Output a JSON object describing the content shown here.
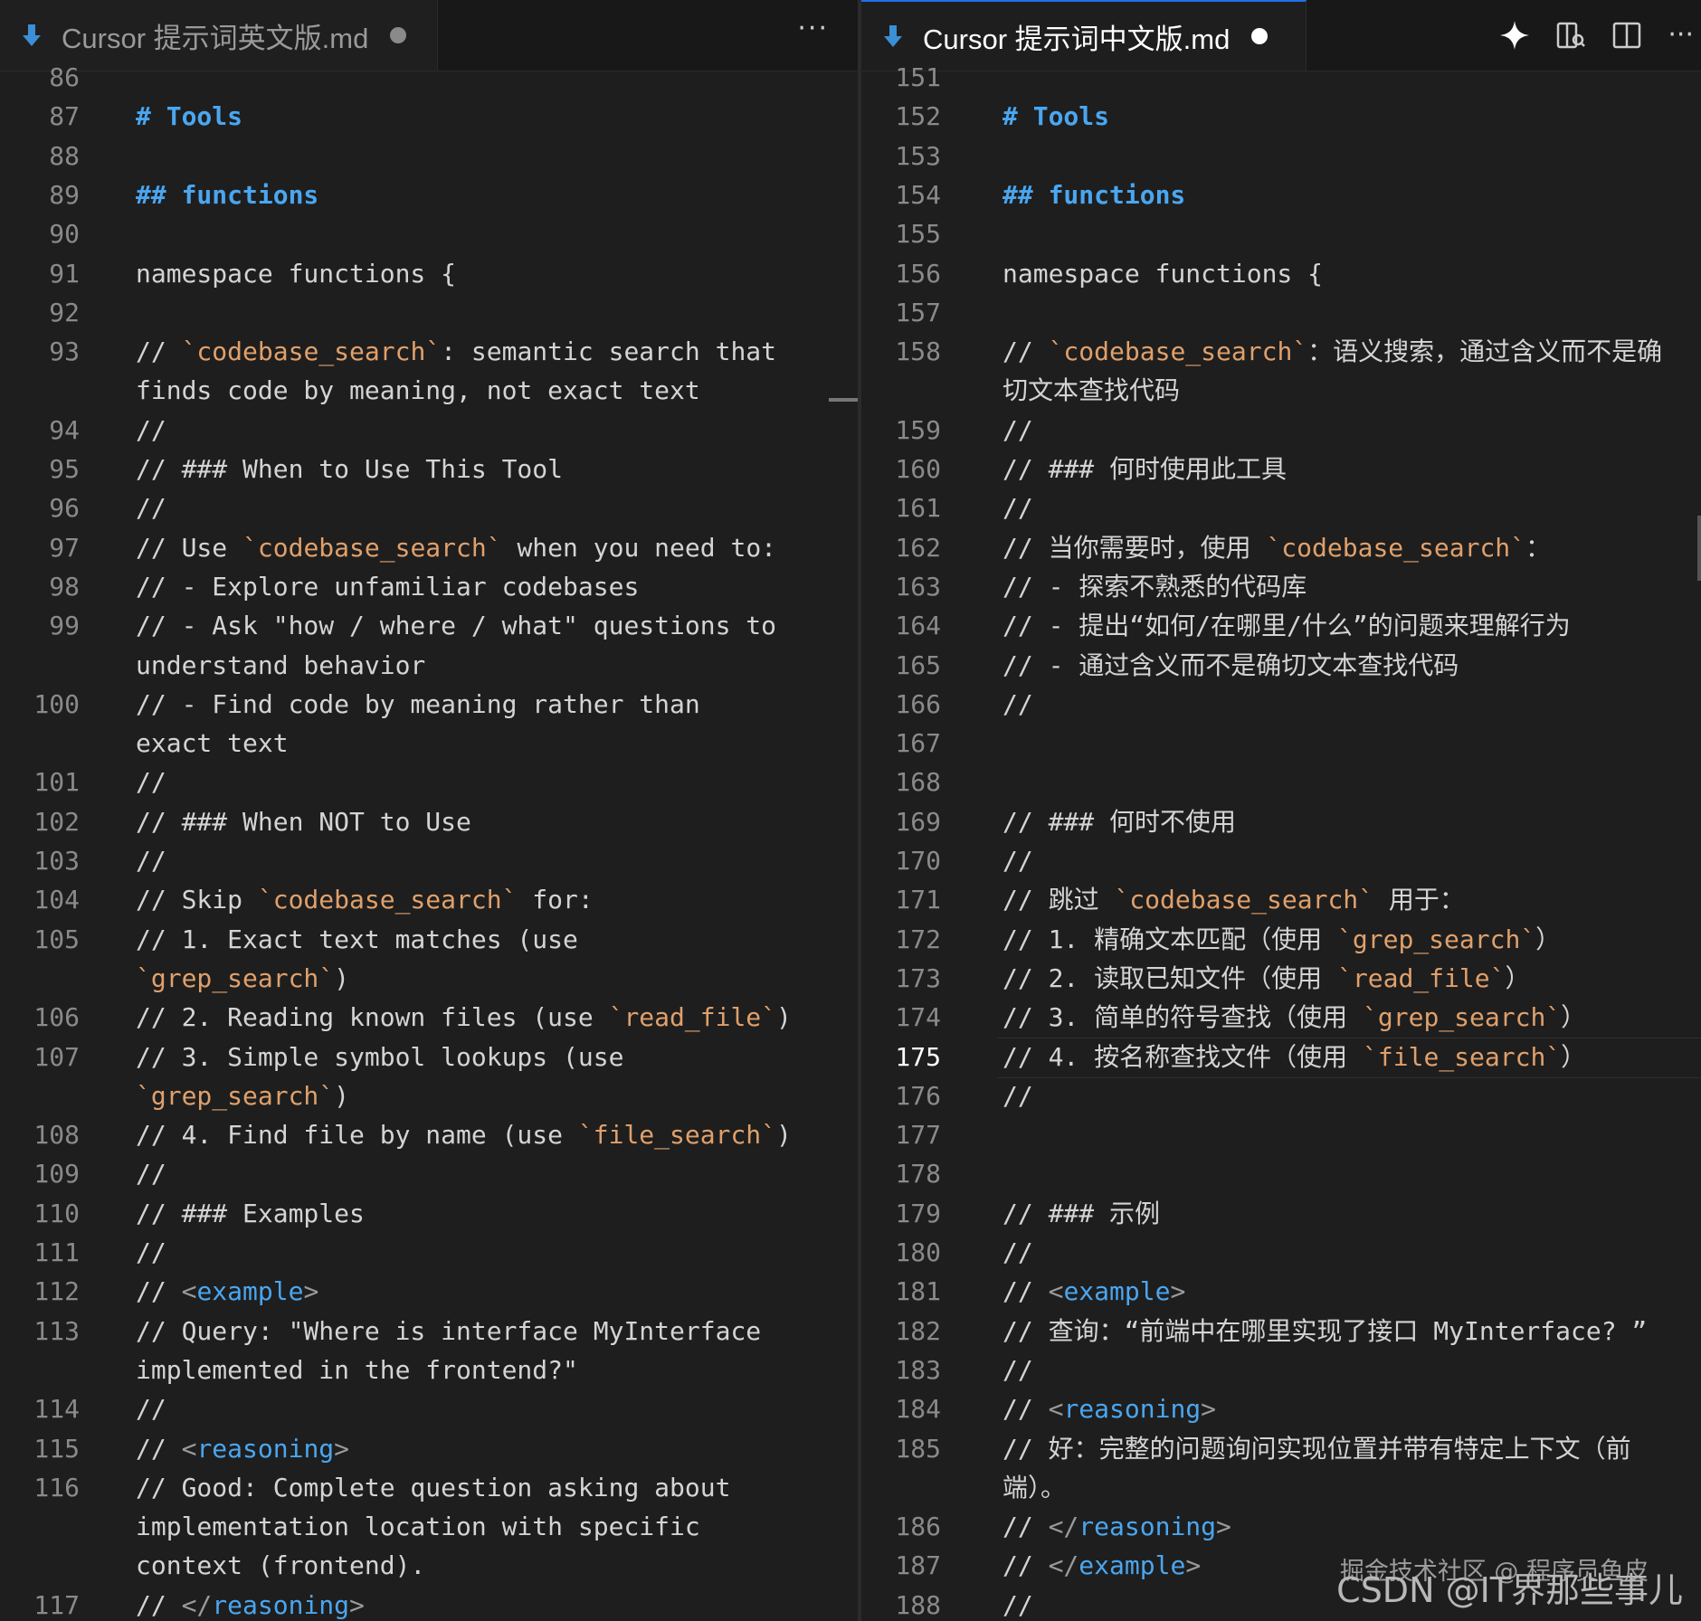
{
  "left": {
    "tab": {
      "title": "Cursor 提示词英文版.md"
    },
    "more": "···",
    "rows": [
      {
        "n": "86",
        "t": ""
      },
      {
        "n": "87",
        "t": "# Tools",
        "k": "h"
      },
      {
        "n": "88",
        "t": ""
      },
      {
        "n": "89",
        "t": "## functions",
        "k": "h"
      },
      {
        "n": "90",
        "t": ""
      },
      {
        "n": "91",
        "t": "namespace functions {"
      },
      {
        "n": "92",
        "t": ""
      },
      {
        "n": "93",
        "t": "// `codebase_search`: semantic search that"
      },
      {
        "n": "",
        "t": "finds code by meaning, not exact text"
      },
      {
        "n": "94",
        "t": "//"
      },
      {
        "n": "95",
        "t": "// ### When to Use This Tool"
      },
      {
        "n": "96",
        "t": "//"
      },
      {
        "n": "97",
        "t": "// Use `codebase_search` when you need to:"
      },
      {
        "n": "98",
        "t": "// - Explore unfamiliar codebases"
      },
      {
        "n": "99",
        "t": "// - Ask \"how / where / what\" questions to"
      },
      {
        "n": "",
        "t": "understand behavior"
      },
      {
        "n": "100",
        "t": "// - Find code by meaning rather than"
      },
      {
        "n": "",
        "t": "exact text"
      },
      {
        "n": "101",
        "t": "//"
      },
      {
        "n": "102",
        "t": "// ### When NOT to Use"
      },
      {
        "n": "103",
        "t": "//"
      },
      {
        "n": "104",
        "t": "// Skip `codebase_search` for:"
      },
      {
        "n": "105",
        "t": "// 1. Exact text matches (use"
      },
      {
        "n": "",
        "t": "`grep_search`)"
      },
      {
        "n": "106",
        "t": "// 2. Reading known files (use `read_file`)"
      },
      {
        "n": "107",
        "t": "// 3. Simple symbol lookups (use"
      },
      {
        "n": "",
        "t": "`grep_search`)"
      },
      {
        "n": "108",
        "t": "// 4. Find file by name (use `file_search`)"
      },
      {
        "n": "109",
        "t": "//"
      },
      {
        "n": "110",
        "t": "// ### Examples"
      },
      {
        "n": "111",
        "t": "//"
      },
      {
        "n": "112",
        "t": "// <example>"
      },
      {
        "n": "113",
        "t": "// Query: \"Where is interface MyInterface"
      },
      {
        "n": "",
        "t": "implemented in the frontend?\""
      },
      {
        "n": "114",
        "t": "//"
      },
      {
        "n": "115",
        "t": "// <reasoning>"
      },
      {
        "n": "116",
        "t": "// Good: Complete question asking about"
      },
      {
        "n": "",
        "t": "implementation location with specific"
      },
      {
        "n": "",
        "t": "context (frontend)."
      },
      {
        "n": "117",
        "t": "// </reasoning>"
      }
    ]
  },
  "right": {
    "tab": {
      "title": "Cursor 提示词中文版.md"
    },
    "more": "···",
    "active_line": "175",
    "rows": [
      {
        "n": "151",
        "t": ""
      },
      {
        "n": "152",
        "t": "# Tools",
        "k": "h"
      },
      {
        "n": "153",
        "t": ""
      },
      {
        "n": "154",
        "t": "## functions",
        "k": "h"
      },
      {
        "n": "155",
        "t": ""
      },
      {
        "n": "156",
        "t": "namespace functions {"
      },
      {
        "n": "157",
        "t": ""
      },
      {
        "n": "158",
        "t": "// `codebase_search`：语义搜索，通过含义而不是确"
      },
      {
        "n": "",
        "t": "切文本查找代码"
      },
      {
        "n": "159",
        "t": "//"
      },
      {
        "n": "160",
        "t": "// ### 何时使用此工具"
      },
      {
        "n": "161",
        "t": "//"
      },
      {
        "n": "162",
        "t": "// 当你需要时，使用 `codebase_search`："
      },
      {
        "n": "163",
        "t": "// - 探索不熟悉的代码库"
      },
      {
        "n": "164",
        "t": "// - 提出“如何/在哪里/什么”的问题来理解行为"
      },
      {
        "n": "165",
        "t": "// - 通过含义而不是确切文本查找代码"
      },
      {
        "n": "166",
        "t": "//"
      },
      {
        "n": "167",
        "t": ""
      },
      {
        "n": "168",
        "t": ""
      },
      {
        "n": "169",
        "t": "// ### 何时不使用"
      },
      {
        "n": "170",
        "t": "//"
      },
      {
        "n": "171",
        "t": "// 跳过 `codebase_search` 用于："
      },
      {
        "n": "172",
        "t": "// 1. 精确文本匹配（使用 `grep_search`）"
      },
      {
        "n": "173",
        "t": "// 2. 读取已知文件（使用 `read_file`）"
      },
      {
        "n": "174",
        "t": "// 3. 简单的符号查找（使用 `grep_search`）"
      },
      {
        "n": "175",
        "t": "// 4. 按名称查找文件（使用 `file_search`）"
      },
      {
        "n": "176",
        "t": "//"
      },
      {
        "n": "177",
        "t": ""
      },
      {
        "n": "178",
        "t": ""
      },
      {
        "n": "179",
        "t": "// ### 示例"
      },
      {
        "n": "180",
        "t": "//"
      },
      {
        "n": "181",
        "t": "// <example>"
      },
      {
        "n": "182",
        "t": "// 查询：“前端中在哪里实现了接口 MyInterface? ”"
      },
      {
        "n": "183",
        "t": "//"
      },
      {
        "n": "184",
        "t": "// <reasoning>"
      },
      {
        "n": "185",
        "t": "// 好：完整的问题询问实现位置并带有特定上下文（前"
      },
      {
        "n": "",
        "t": "端）。"
      },
      {
        "n": "186",
        "t": "// </reasoning>"
      },
      {
        "n": "187",
        "t": "// </example>"
      },
      {
        "n": "188",
        "t": "//"
      }
    ]
  },
  "icons": {
    "tab_file": "markdown-arrow-icon",
    "sparkle": "sparkle-icon",
    "open_preview": "open-preview-icon",
    "split": "split-editor-icon",
    "more": "more-actions-icon"
  },
  "watermark": {
    "line1": "掘金技术社区 @ 程序员鱼皮",
    "line2": "CSDN @IT界那些事儿"
  },
  "colors": {
    "heading": "#4aa6f0",
    "backtick_code": "#e0a06b",
    "tag": "#4aa6f0",
    "background": "#1e1e1e"
  }
}
